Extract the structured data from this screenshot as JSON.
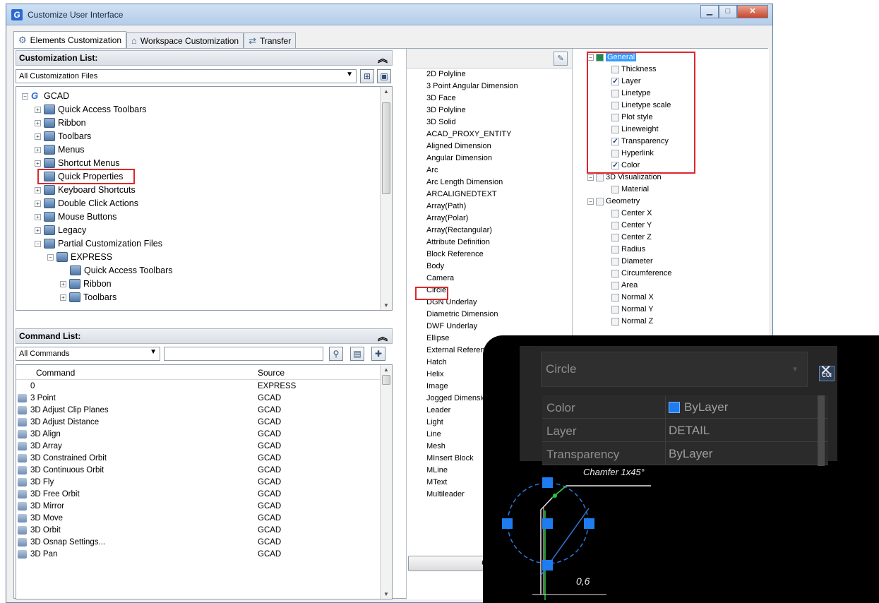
{
  "window": {
    "title": "Customize User Interface"
  },
  "tabs": [
    {
      "label": "Elements Customization"
    },
    {
      "label": "Workspace Customization"
    },
    {
      "label": "Transfer"
    }
  ],
  "customization_list": {
    "header": "Customization List:",
    "files_combo": "All Customization Files",
    "tree": [
      {
        "label": "GCAD"
      },
      {
        "label": "Quick Access Toolbars"
      },
      {
        "label": "Ribbon"
      },
      {
        "label": "Toolbars"
      },
      {
        "label": "Menus"
      },
      {
        "label": "Shortcut Menus"
      },
      {
        "label": "Quick Properties"
      },
      {
        "label": "Keyboard Shortcuts"
      },
      {
        "label": "Double Click Actions"
      },
      {
        "label": "Mouse Buttons"
      },
      {
        "label": "Legacy"
      },
      {
        "label": "Partial Customization Files"
      },
      {
        "label": "EXPRESS"
      },
      {
        "label": "Quick Access Toolbars"
      },
      {
        "label": "Ribbon"
      },
      {
        "label": "Toolbars"
      }
    ]
  },
  "command_list": {
    "header": "Command List:",
    "filter_combo": "All Commands",
    "search_value": "",
    "col_command": "Command",
    "col_source": "Source",
    "rows": [
      {
        "command": "0",
        "source": "EXPRESS"
      },
      {
        "command": "3 Point",
        "source": "GCAD"
      },
      {
        "command": "3D Adjust Clip Planes",
        "source": "GCAD"
      },
      {
        "command": "3D Adjust Distance",
        "source": "GCAD"
      },
      {
        "command": "3D Align",
        "source": "GCAD"
      },
      {
        "command": "3D Array",
        "source": "GCAD"
      },
      {
        "command": "3D Constrained Orbit",
        "source": "GCAD"
      },
      {
        "command": "3D Continuous Orbit",
        "source": "GCAD"
      },
      {
        "command": "3D Fly",
        "source": "GCAD"
      },
      {
        "command": "3D Free Orbit",
        "source": "GCAD"
      },
      {
        "command": "3D Mirror",
        "source": "GCAD"
      },
      {
        "command": "3D Move",
        "source": "GCAD"
      },
      {
        "command": "3D Orbit",
        "source": "GCAD"
      },
      {
        "command": "3D Osnap Settings...",
        "source": "GCAD"
      },
      {
        "command": "3D Pan",
        "source": "GCAD"
      }
    ]
  },
  "object_types": [
    "2D Polyline",
    "3 Point Angular Dimension",
    "3D Face",
    "3D Polyline",
    "3D Solid",
    "ACAD_PROXY_ENTITY",
    "Aligned Dimension",
    "Angular Dimension",
    "Arc",
    "Arc Length Dimension",
    "ARCALIGNEDTEXT",
    "Array(Path)",
    "Array(Polar)",
    "Array(Rectangular)",
    "Attribute Definition",
    "Block Reference",
    "Body",
    "Camera",
    "Circle",
    "DGN Underlay",
    "Diametric Dimension",
    "DWF Underlay",
    "Ellipse",
    "External Reference",
    "Hatch",
    "Helix",
    "Image",
    "Jogged Dimension",
    "Leader",
    "Light",
    "Line",
    "Mesh",
    "MInsert Block",
    "MLine",
    "MText",
    "Multileader"
  ],
  "general_button": "Gen",
  "properties": {
    "general": {
      "label": "General",
      "items": [
        {
          "label": "Thickness",
          "checked": false
        },
        {
          "label": "Layer",
          "checked": true
        },
        {
          "label": "Linetype",
          "checked": false
        },
        {
          "label": "Linetype scale",
          "checked": false
        },
        {
          "label": "Plot style",
          "checked": false
        },
        {
          "label": "Lineweight",
          "checked": false
        },
        {
          "label": "Transparency",
          "checked": true
        },
        {
          "label": "Hyperlink",
          "checked": false
        },
        {
          "label": "Color",
          "checked": true
        }
      ]
    },
    "visualization": {
      "label": "3D Visualization",
      "items": [
        {
          "label": "Material",
          "checked": false
        }
      ]
    },
    "geometry": {
      "label": "Geometry",
      "items": [
        {
          "label": "Center X",
          "checked": false
        },
        {
          "label": "Center Y",
          "checked": false
        },
        {
          "label": "Center Z",
          "checked": false
        },
        {
          "label": "Radius",
          "checked": false
        },
        {
          "label": "Diameter",
          "checked": false
        },
        {
          "label": "Circumference",
          "checked": false
        },
        {
          "label": "Area",
          "checked": false
        },
        {
          "label": "Normal X",
          "checked": false
        },
        {
          "label": "Normal Y",
          "checked": false
        },
        {
          "label": "Normal Z",
          "checked": false
        }
      ]
    }
  },
  "quick_properties_preview": {
    "object": "Circle",
    "cui_icon": "CUI",
    "rows": [
      {
        "key": "Color",
        "value": "ByLayer",
        "swatch": "#1e7cf0"
      },
      {
        "key": "Layer",
        "value": "DETAIL"
      },
      {
        "key": "Transparency",
        "value": "ByLayer"
      }
    ],
    "annotation": "Chamfer 1x45°",
    "dimension": "0,6"
  },
  "colors": {
    "highlight": "#e0262c",
    "selection": "#3399ff",
    "overlay_bg": "#000000"
  }
}
